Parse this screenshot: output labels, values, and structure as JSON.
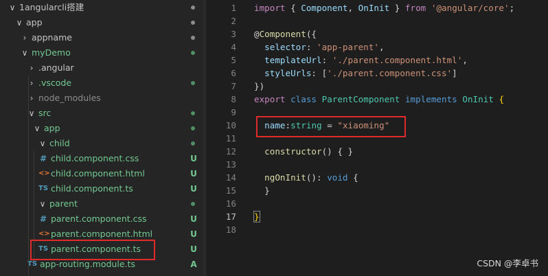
{
  "explorer": {
    "items": [
      {
        "label": "1angularcli搭建",
        "chevron": "∨",
        "icon": "",
        "status": "dot",
        "color": "#c5c5c5"
      },
      {
        "label": "app",
        "chevron": "∨",
        "icon": "",
        "status": "dot",
        "color": "#c5c5c5"
      },
      {
        "label": "appname",
        "chevron": "›",
        "icon": "",
        "status": "dot",
        "color": "#c5c5c5"
      },
      {
        "label": "myDemo",
        "chevron": "∨",
        "icon": "",
        "status": "dot-green",
        "color": "#73c991"
      },
      {
        "label": ".angular",
        "chevron": "›",
        "icon": "",
        "status": "",
        "color": "#c5c5c5"
      },
      {
        "label": ".vscode",
        "chevron": "›",
        "icon": "",
        "status": "dot-green",
        "color": "#73c991"
      },
      {
        "label": "node_modules",
        "chevron": "›",
        "icon": "",
        "status": "",
        "color": "#8c8c8c"
      },
      {
        "label": "src",
        "chevron": "∨",
        "icon": "",
        "status": "dot-green",
        "color": "#73c991"
      },
      {
        "label": "app",
        "chevron": "∨",
        "icon": "",
        "status": "dot-green",
        "color": "#73c991"
      },
      {
        "label": "child",
        "chevron": "∨",
        "icon": "",
        "status": "dot-green",
        "color": "#73c991"
      },
      {
        "label": "child.component.css",
        "chevron": "",
        "icon": "#",
        "status": "U",
        "color": "#73c991"
      },
      {
        "label": "child.component.html",
        "chevron": "",
        "icon": "<>",
        "status": "U",
        "color": "#73c991"
      },
      {
        "label": "child.component.ts",
        "chevron": "",
        "icon": "TS",
        "status": "U",
        "color": "#73c991"
      },
      {
        "label": "parent",
        "chevron": "∨",
        "icon": "",
        "status": "dot-green",
        "color": "#73c991"
      },
      {
        "label": "parent.component.css",
        "chevron": "",
        "icon": "#",
        "status": "U",
        "color": "#73c991"
      },
      {
        "label": "parent.component.html",
        "chevron": "",
        "icon": "<>",
        "status": "U",
        "color": "#73c991"
      },
      {
        "label": "parent.component.ts",
        "chevron": "",
        "icon": "TS",
        "status": "U",
        "color": "#73c991"
      },
      {
        "label": "app-routing.module.ts",
        "chevron": "",
        "icon": "TS",
        "status": "A",
        "color": "#73c991"
      }
    ]
  },
  "editor": {
    "lines": [
      {
        "n": "1",
        "t": [
          [
            "kw2",
            "import"
          ],
          [
            "pl",
            " { "
          ],
          [
            "prop",
            "Component"
          ],
          [
            "pl",
            ", "
          ],
          [
            "prop",
            "OnInit"
          ],
          [
            "pl",
            " } "
          ],
          [
            "kw2",
            "from"
          ],
          [
            "pl",
            " "
          ],
          [
            "str",
            "'@angular/core'"
          ],
          [
            "pl",
            ";"
          ]
        ]
      },
      {
        "n": "2",
        "t": []
      },
      {
        "n": "3",
        "t": [
          [
            "pl",
            "@"
          ],
          [
            "fn",
            "Component"
          ],
          [
            "pl",
            "({"
          ]
        ]
      },
      {
        "n": "4",
        "t": [
          [
            "pl",
            "  "
          ],
          [
            "prop",
            "selector"
          ],
          [
            "pl",
            ": "
          ],
          [
            "str",
            "'app-parent'"
          ],
          [
            "pl",
            ","
          ]
        ]
      },
      {
        "n": "5",
        "t": [
          [
            "pl",
            "  "
          ],
          [
            "prop",
            "templateUrl"
          ],
          [
            "pl",
            ": "
          ],
          [
            "str",
            "'./parent.component.html'"
          ],
          [
            "pl",
            ","
          ]
        ]
      },
      {
        "n": "6",
        "t": [
          [
            "pl",
            "  "
          ],
          [
            "prop",
            "styleUrls"
          ],
          [
            "pl",
            ": ["
          ],
          [
            "str",
            "'./parent.component.css'"
          ],
          [
            "pl",
            "]"
          ]
        ]
      },
      {
        "n": "7",
        "t": [
          [
            "pl",
            "})"
          ]
        ]
      },
      {
        "n": "8",
        "t": [
          [
            "kw2",
            "export"
          ],
          [
            "pl",
            " "
          ],
          [
            "kw",
            "class"
          ],
          [
            "pl",
            " "
          ],
          [
            "ty",
            "ParentComponent"
          ],
          [
            "pl",
            " "
          ],
          [
            "kw",
            "implements"
          ],
          [
            "pl",
            " "
          ],
          [
            "ty",
            "OnInit"
          ],
          [
            "pl",
            " "
          ],
          [
            "brk",
            "{"
          ]
        ]
      },
      {
        "n": "9",
        "t": []
      },
      {
        "n": "10",
        "t": [
          [
            "pl",
            "  "
          ],
          [
            "prop",
            "name"
          ],
          [
            "pl",
            ":"
          ],
          [
            "ty",
            "string"
          ],
          [
            "pl",
            " = "
          ],
          [
            "str",
            "\"xiaoming\""
          ]
        ]
      },
      {
        "n": "11",
        "t": []
      },
      {
        "n": "12",
        "t": [
          [
            "pl",
            "  "
          ],
          [
            "fn",
            "constructor"
          ],
          [
            "pl",
            "() { }"
          ]
        ]
      },
      {
        "n": "13",
        "t": []
      },
      {
        "n": "14",
        "t": [
          [
            "pl",
            "  "
          ],
          [
            "fn",
            "ngOnInit"
          ],
          [
            "pl",
            "(): "
          ],
          [
            "kw",
            "void"
          ],
          [
            "pl",
            " {"
          ]
        ]
      },
      {
        "n": "15",
        "t": [
          [
            "pl",
            "  }"
          ]
        ]
      },
      {
        "n": "16",
        "t": []
      },
      {
        "n": "17",
        "t": [
          [
            "brk",
            "}"
          ]
        ]
      },
      {
        "n": "18",
        "t": []
      }
    ]
  },
  "watermark": "CSDN @李卓书"
}
